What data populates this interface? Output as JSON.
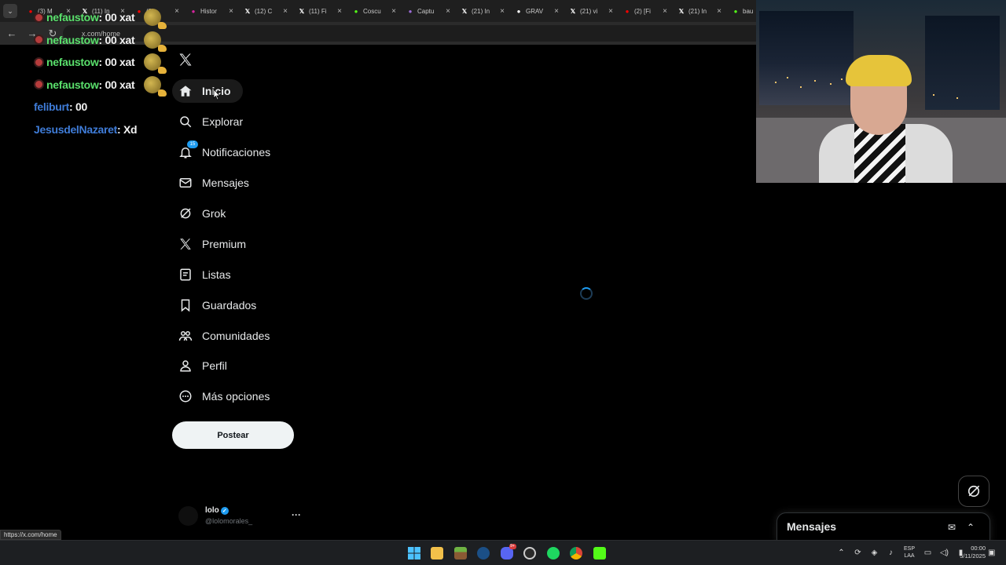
{
  "browser": {
    "tabs": [
      {
        "label": "(3) M",
        "icon": "youtube-icon",
        "color": "#ff0000"
      },
      {
        "label": "(11) In",
        "icon": "x-icon",
        "color": "#ffffff"
      },
      {
        "label": "(2)",
        "icon": "youtube-icon",
        "color": "#ff0000"
      },
      {
        "label": "Histor",
        "icon": "instagram-icon",
        "color": "#d6249f"
      },
      {
        "label": "(12) C",
        "icon": "x-icon",
        "color": "#ffffff"
      },
      {
        "label": "(11) Fi",
        "icon": "x-icon",
        "color": "#ffffff"
      },
      {
        "label": "Coscu",
        "icon": "kick-icon",
        "color": "#53fc18"
      },
      {
        "label": "Captu",
        "icon": "pen-icon",
        "color": "#9b6bd6"
      },
      {
        "label": "(21) In",
        "icon": "x-icon",
        "color": "#ffffff"
      },
      {
        "label": "GRAV",
        "icon": "tiktok-icon",
        "color": "#ffffff"
      },
      {
        "label": "(21) vi",
        "icon": "x-icon",
        "color": "#ffffff"
      },
      {
        "label": "(2) [Fi",
        "icon": "youtube-icon",
        "color": "#ff0000"
      },
      {
        "label": "(21) In",
        "icon": "x-icon",
        "color": "#ffffff"
      },
      {
        "label": "bau",
        "icon": "kick-icon",
        "color": "#53fc18"
      }
    ],
    "url": "x.com/home",
    "status_url": "https://x.com/home"
  },
  "chat": {
    "lines": [
      {
        "user": "nefaustow",
        "message": ": 00 xat",
        "color": "#5ae06c",
        "emote": true
      },
      {
        "user": "nefaustow",
        "message": ": 00 xat",
        "color": "#5ae06c",
        "emote": true
      },
      {
        "user": "nefaustow",
        "message": ": 00 xat",
        "color": "#5ae06c",
        "emote": true
      },
      {
        "user": "nefaustow",
        "message": ": 00 xat",
        "color": "#5ae06c",
        "emote": true
      },
      {
        "user": "feliburt",
        "message": ": 00",
        "color": "#3f7cd8",
        "emote": false
      },
      {
        "user": "JesusdelNazaret",
        "message": ": Xd",
        "color": "#3f7cd8",
        "emote": false
      }
    ]
  },
  "sidebar": {
    "items": [
      {
        "label": "Inicio",
        "icon": "home-icon",
        "active": true
      },
      {
        "label": "Explorar",
        "icon": "search-icon"
      },
      {
        "label": "Notificaciones",
        "icon": "bell-icon",
        "badge": "15"
      },
      {
        "label": "Mensajes",
        "icon": "mail-icon"
      },
      {
        "label": "Grok",
        "icon": "grok-icon"
      },
      {
        "label": "Premium",
        "icon": "x-icon"
      },
      {
        "label": "Listas",
        "icon": "list-icon"
      },
      {
        "label": "Guardados",
        "icon": "bookmark-icon"
      },
      {
        "label": "Comunidades",
        "icon": "people-icon"
      },
      {
        "label": "Perfil",
        "icon": "user-icon"
      },
      {
        "label": "Más opciones",
        "icon": "more-circle-icon"
      }
    ],
    "post_label": "Postear"
  },
  "profile": {
    "name": "lolo",
    "handle": "@lolomorales_",
    "more": "···"
  },
  "messages_panel": {
    "title": "Mensajes"
  },
  "taskbar": {
    "lang": [
      "ESP",
      "LAA"
    ],
    "time": "00:00",
    "date": "5/11/2025",
    "discord_badge": "9+"
  },
  "colors": {
    "accent": "#1d9bf0",
    "background": "#000000",
    "text": "#e7e9ea"
  }
}
